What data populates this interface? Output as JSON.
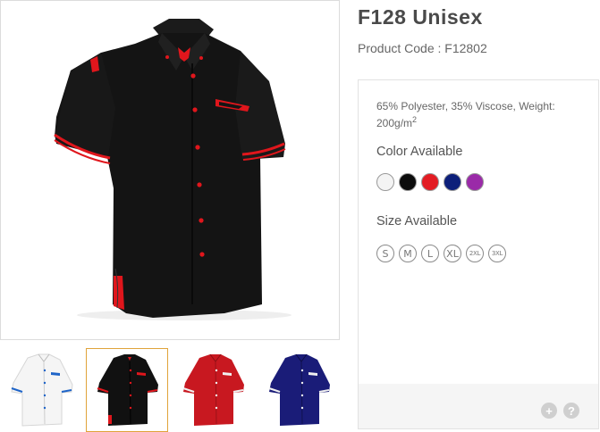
{
  "product": {
    "title": "F128 Unisex",
    "code": "Product Code : F12802"
  },
  "details": {
    "material": "65% Polyester, 35% Viscose, Weight: 200g/m",
    "material_sup": "2",
    "color_heading": "Color Available",
    "size_heading": "Size Available",
    "colors": [
      {
        "name": "white",
        "hex": "#f4f4f4"
      },
      {
        "name": "black",
        "hex": "#0c0c0c"
      },
      {
        "name": "red",
        "hex": "#e31c23"
      },
      {
        "name": "navy",
        "hex": "#0c1f7a"
      },
      {
        "name": "purple",
        "hex": "#9a2aa8"
      }
    ],
    "sizes": [
      "S",
      "M",
      "L",
      "XL",
      "2XL",
      "3XL"
    ]
  },
  "footer": {
    "zoom_icon": "plus-icon",
    "zoom_label": "+",
    "help_icon": "question-icon",
    "help_label": "?"
  },
  "gallery": {
    "selected": 1,
    "thumbnails": [
      {
        "name": "white-shirt",
        "body": "#f5f5f5",
        "trim": "#1e64c8",
        "button": "#1e64c8"
      },
      {
        "name": "black-shirt",
        "body": "#111111",
        "trim": "#e0161c",
        "button": "#e0161c"
      },
      {
        "name": "red-shirt",
        "body": "#c81820",
        "trim": "#f0f0f0",
        "button": "#f0f0f0"
      },
      {
        "name": "navy-shirt",
        "body": "#1a1c78",
        "trim": "#f0f0f0",
        "button": "#f0f0f0"
      }
    ]
  }
}
